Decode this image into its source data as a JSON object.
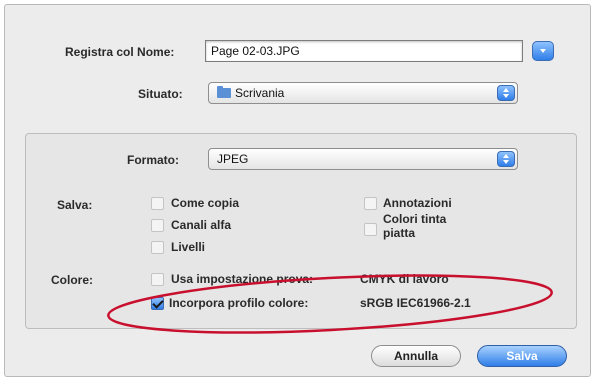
{
  "save": {
    "name_label": "Registra col Nome:",
    "name_value": "Page 02-03.JPG",
    "where_label": "Situato:",
    "where_value": "Scrivania"
  },
  "options": {
    "format_label": "Formato:",
    "format_value": "JPEG",
    "save_label": "Salva:",
    "save_as_copy": "Come copia",
    "alpha_channels": "Canali alfa",
    "layers": "Livelli",
    "annotations": "Annotazioni",
    "spot_colors": "Colori tinta piatta",
    "color_label": "Colore:",
    "use_proof_setup": "Usa impostazione prova:",
    "proof_profile": "CMYK di lavoro",
    "embed_profile": "Incorpora profilo colore:",
    "embed_profile_value": "sRGB IEC61966-2.1"
  },
  "buttons": {
    "cancel": "Annulla",
    "save": "Salva"
  },
  "colors": {
    "accent": "#2f7ee8",
    "annotation": "#c8102e"
  }
}
